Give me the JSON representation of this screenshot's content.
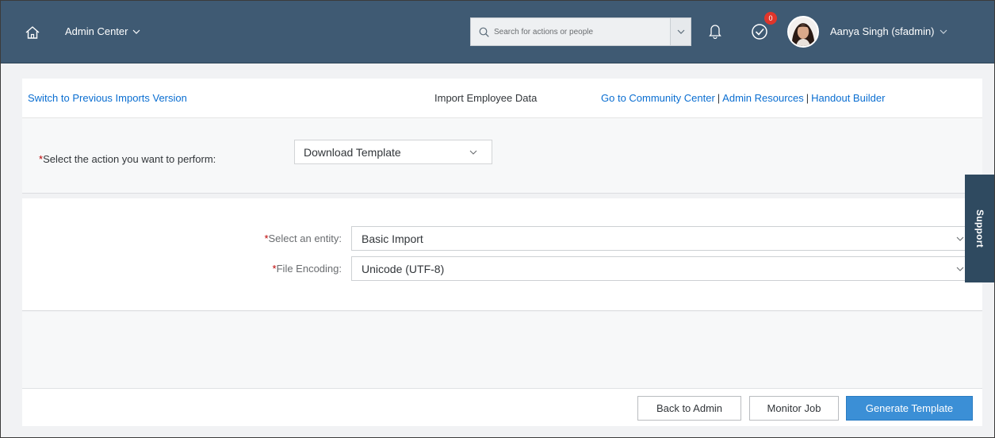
{
  "shell": {
    "app_title": "Admin Center",
    "search_placeholder": "Search for actions or people",
    "notification_count": "0",
    "user_name": "Aanya Singh (sfadmin)"
  },
  "links": {
    "switch_previous": "Switch to Previous Imports Version",
    "page_title": "Import Employee Data",
    "community": "Go to Community Center",
    "admin_resources": "Admin Resources",
    "handout_builder": "Handout Builder",
    "separator": "|"
  },
  "action": {
    "required_mark": "*",
    "label": "Select the action you want to perform:",
    "selected": "Download Template"
  },
  "form": {
    "entity": {
      "required_mark": "*",
      "label": "Select an entity:",
      "selected": "Basic Import"
    },
    "encoding": {
      "required_mark": "*",
      "label": "File Encoding:",
      "selected": "Unicode (UTF-8)"
    }
  },
  "footer": {
    "back": "Back to Admin",
    "monitor": "Monitor Job",
    "generate": "Generate Template"
  },
  "support": {
    "label": "Support"
  },
  "colors": {
    "shell_bg": "#3f5a73",
    "link": "#0a6ed1",
    "primary_button": "#3b8fd6",
    "required": "#bb0000",
    "support_tab": "#2f4a60"
  },
  "icons": {
    "home": "home-icon",
    "search": "search-icon",
    "bell": "bell-icon",
    "todo": "todo-check-icon",
    "chevron": "chevron-down-icon"
  }
}
